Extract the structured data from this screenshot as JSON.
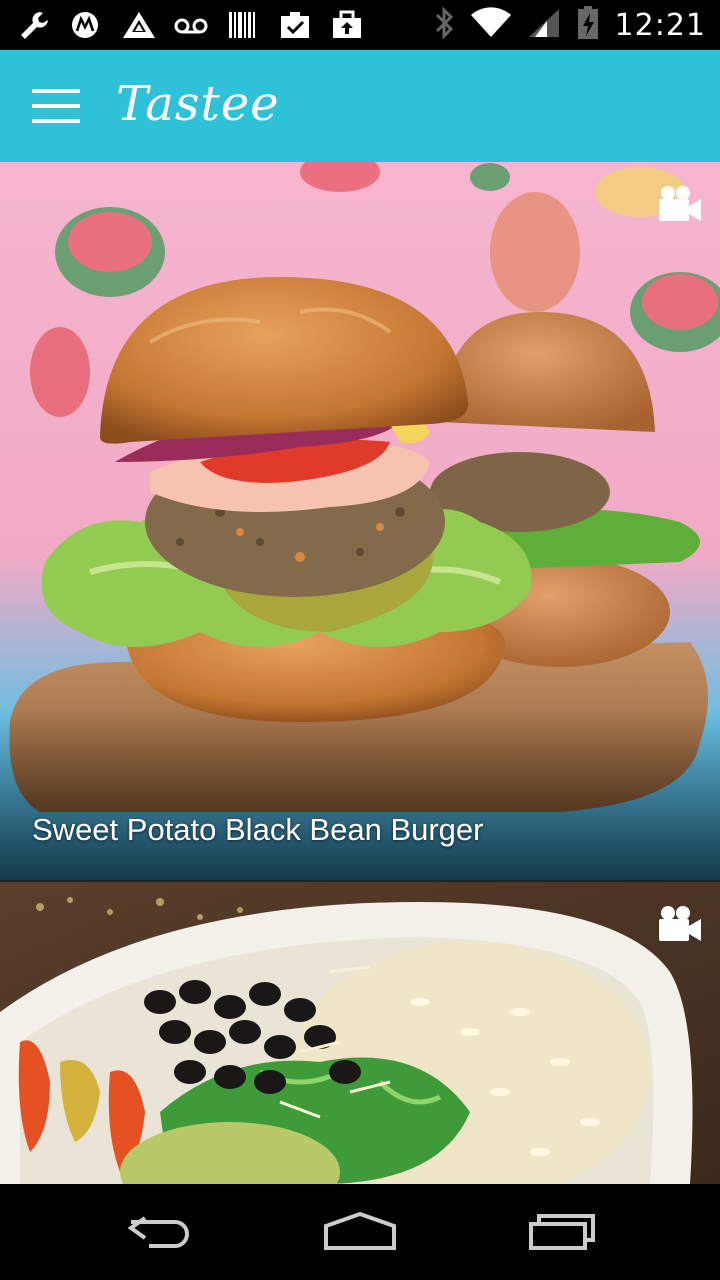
{
  "status_bar": {
    "time": "12:21",
    "left_icons": [
      "wrench-icon",
      "motorola-icon",
      "network-icon",
      "voicemail-icon",
      "barcode-icon",
      "clipboard-check-icon",
      "bag-upload-icon"
    ],
    "right_icons": [
      "bluetooth-icon",
      "wifi-icon",
      "cell-signal-icon",
      "battery-charging-icon"
    ]
  },
  "app_bar": {
    "title": "Tastee",
    "background": "#2fc1d8",
    "menu_icon": "hamburger-menu-icon"
  },
  "feed": {
    "items": [
      {
        "title": "Sweet Potato Black Bean Burger",
        "media_type": "video",
        "badge_icon": "video-camera-icon"
      },
      {
        "title": "",
        "media_type": "video",
        "badge_icon": "video-camera-icon"
      }
    ]
  },
  "nav_bar": {
    "icons": [
      "back-icon",
      "home-icon",
      "recent-apps-icon"
    ]
  }
}
